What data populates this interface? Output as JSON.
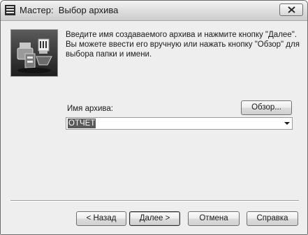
{
  "window": {
    "title": "Мастер:  Выбор архива"
  },
  "description": "Введите имя создаваемого архива и нажмите кнопку \"Далее\". Вы можете ввести его вручную или нажать кнопку \"Обзор\" для выбора папки и имени.",
  "archive": {
    "label": "Имя архива:",
    "browse_label": "Обзор...",
    "value": "ОТЧЕТ"
  },
  "buttons": {
    "back": "< Назад",
    "next": "Далее >",
    "cancel": "Отмена",
    "help": "Справка"
  },
  "icons": {
    "app": "archive-stack-icon",
    "close": "close-icon",
    "wizard": "archive-wizard-image",
    "dropdown": "chevron-down-icon"
  }
}
